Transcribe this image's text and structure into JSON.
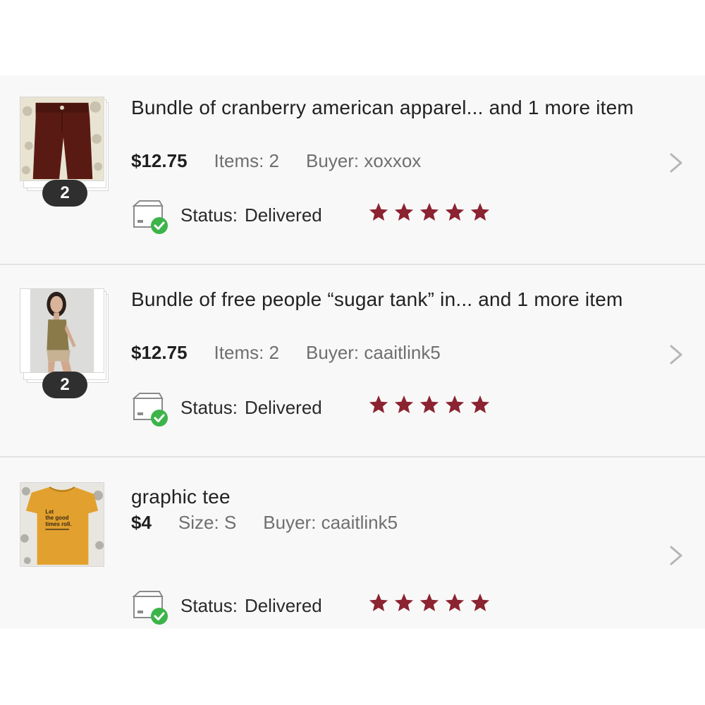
{
  "colors": {
    "star": "#8b2331",
    "check": "#3cb44a",
    "row_bg": "#f9f8f8",
    "divider": "#e3e1e1"
  },
  "orders": [
    {
      "title": "Bundle of cranberry american apparel... and 1 more item",
      "price": "$12.75",
      "detail": "Items: 2",
      "buyer": "Buyer: xoxxox",
      "count_badge": "2",
      "status_label": "Status:",
      "status_value": "Delivered",
      "rating": 5,
      "thumbnail_icon": "cranberry-pants-photo"
    },
    {
      "title": "Bundle of free people “sugar tank” in... and 1 more item",
      "price": "$12.75",
      "detail": "Items: 2",
      "buyer": "Buyer: caaitlink5",
      "count_badge": "2",
      "status_label": "Status:",
      "status_value": "Delivered",
      "rating": 5,
      "thumbnail_icon": "model-tank-photo"
    },
    {
      "title": "graphic tee",
      "price": "$4",
      "detail": "Size: S",
      "buyer": "Buyer: caaitlink5",
      "status_label": "Status:",
      "status_value": "Delivered",
      "rating": 5,
      "thumbnail_icon": "graphic-tee-photo",
      "thumbnail_text": [
        "Let",
        "the good",
        "times roll."
      ]
    }
  ]
}
